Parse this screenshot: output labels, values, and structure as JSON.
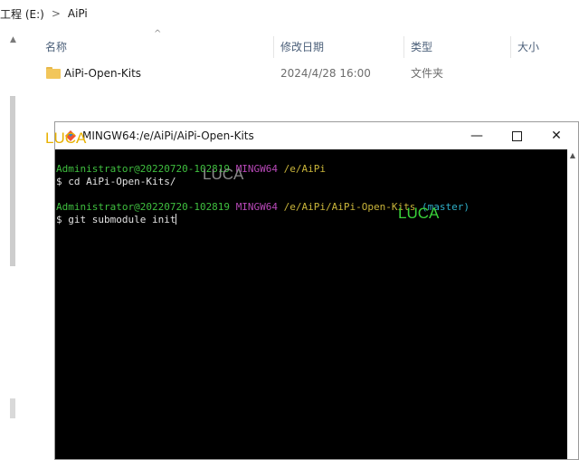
{
  "explorer": {
    "breadcrumb": [
      "工程 (E:)",
      "AiPi"
    ],
    "breadcrumb_separator": ">",
    "columns": {
      "name": "名称",
      "modified": "修改日期",
      "type": "类型",
      "size": "大小"
    },
    "files": [
      {
        "name": "AiPi-Open-Kits",
        "modified": "2024/4/28 16:00",
        "type": "文件夹",
        "icon": "folder-icon"
      }
    ]
  },
  "terminal": {
    "title": "MINGW64:/e/AiPi/AiPi-Open-Kits",
    "controls": {
      "minimize": "—",
      "close": "✕"
    },
    "lines": [
      {
        "user": "Administrator@20220720-102819",
        "env": "MINGW64",
        "path": "/e/AiPi",
        "branch": ""
      },
      {
        "command": "$ cd AiPi-Open-Kits/"
      },
      {
        "user": "Administrator@20220720-102819",
        "env": "MINGW64",
        "path": "/e/AiPi/AiPi-Open-Kits",
        "branch": "(master)"
      },
      {
        "command": "$ git submodule init"
      }
    ]
  },
  "watermarks": [
    "LUCA",
    "LUCA",
    "LUCA"
  ],
  "colors": {
    "prompt_user": "#3fbf3f",
    "prompt_env": "#b848b8",
    "prompt_path": "#c9b53a",
    "prompt_branch": "#2fb0c9",
    "terminal_bg": "#000000",
    "folder": "#f2c65a"
  }
}
